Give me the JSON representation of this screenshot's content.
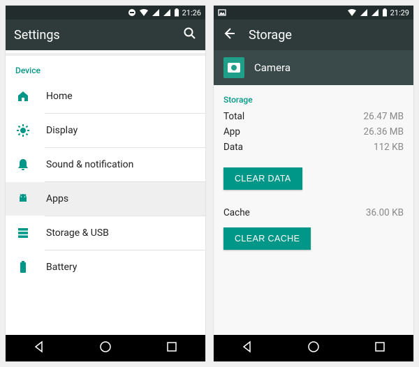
{
  "accent": "#009688",
  "left": {
    "status_time": "21:26",
    "title": "Settings",
    "section": "Device",
    "items": [
      {
        "label": "Home",
        "selected": false
      },
      {
        "label": "Display",
        "selected": false
      },
      {
        "label": "Sound & notification",
        "selected": false
      },
      {
        "label": "Apps",
        "selected": true
      },
      {
        "label": "Storage & USB",
        "selected": false
      },
      {
        "label": "Battery",
        "selected": false
      }
    ]
  },
  "right": {
    "status_time": "21:29",
    "title": "Storage",
    "app_name": "Camera",
    "section": "Storage",
    "rows": {
      "total": {
        "k": "Total",
        "v": "26.47 MB"
      },
      "app": {
        "k": "App",
        "v": "26.36 MB"
      },
      "data": {
        "k": "Data",
        "v": "112 KB"
      },
      "cache": {
        "k": "Cache",
        "v": "36.00 KB"
      }
    },
    "buttons": {
      "clear_data": "CLEAR DATA",
      "clear_cache": "CLEAR CACHE"
    }
  }
}
